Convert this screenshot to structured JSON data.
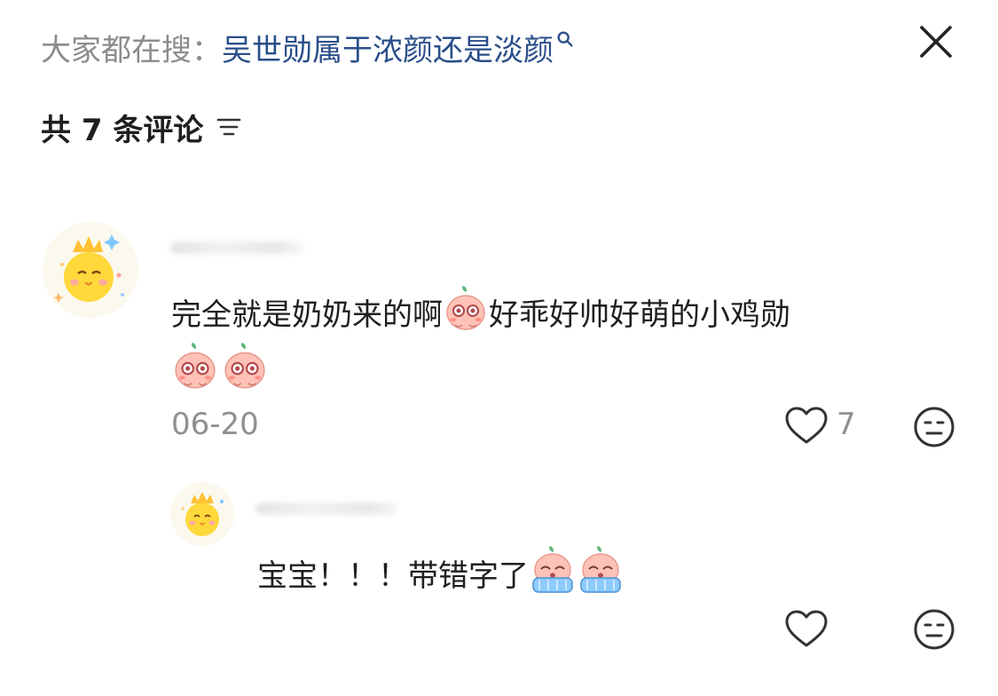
{
  "search": {
    "prefix": "大家都在搜：",
    "query": "吴世勋属于浓颜还是淡颜"
  },
  "comments_header": {
    "count_label": "共 7 条评论"
  },
  "comments": [
    {
      "text_line1": "完全就是奶奶来的啊",
      "text_line1b": "好乖好帅好萌的小鸡勋",
      "date": "06-20",
      "likes": "7"
    }
  ],
  "replies": [
    {
      "text": "宝宝！！！带错字了"
    }
  ],
  "icons": {
    "close": "close-icon",
    "sort": "sort-icon",
    "like": "heart-icon",
    "dislike": "meh-face-icon",
    "emoji_blush": "peach-blush-emoji",
    "emoji_cry": "peach-cry-emoji"
  },
  "colors": {
    "query_link": "#2a4e8a",
    "muted": "#8f8f8f"
  }
}
